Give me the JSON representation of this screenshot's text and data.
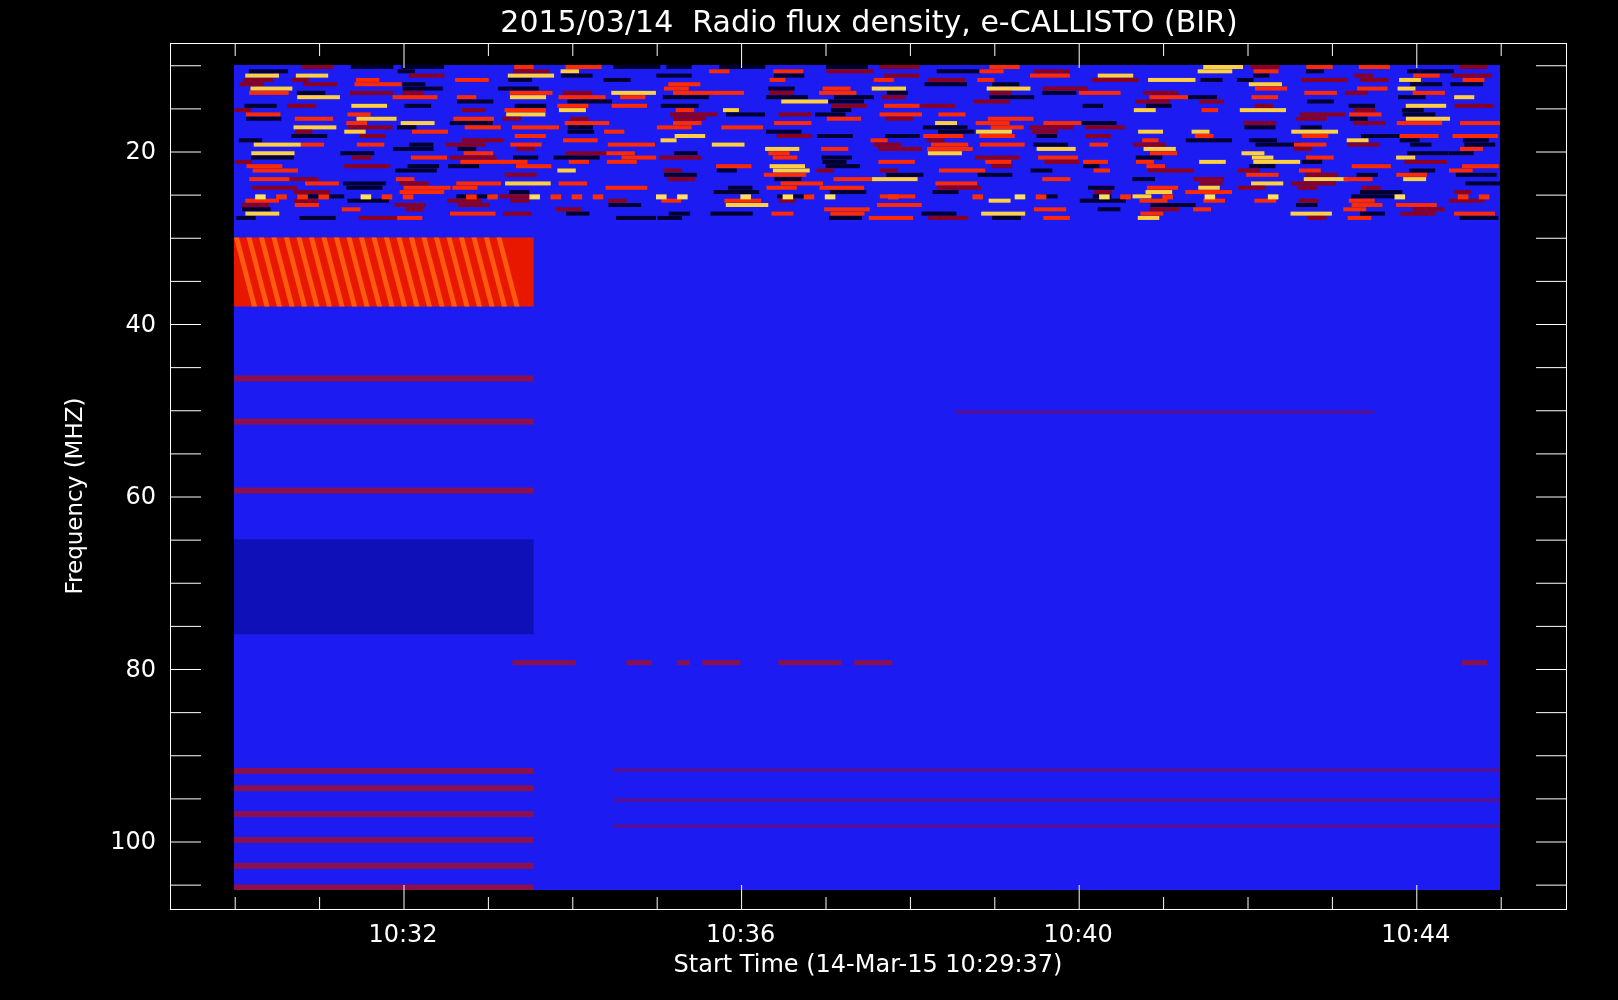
{
  "title": "2015/03/14  Radio flux density, e-CALLISTO (BIR)",
  "y_axis": {
    "label": "Frequency (MHZ)",
    "ticks": [
      "20",
      "40",
      "60",
      "80",
      "100"
    ]
  },
  "x_axis": {
    "label": "Start Time (14-Mar-15 10:29:37)",
    "ticks": [
      "10:32",
      "10:36",
      "10:40",
      "10:44"
    ]
  }
}
